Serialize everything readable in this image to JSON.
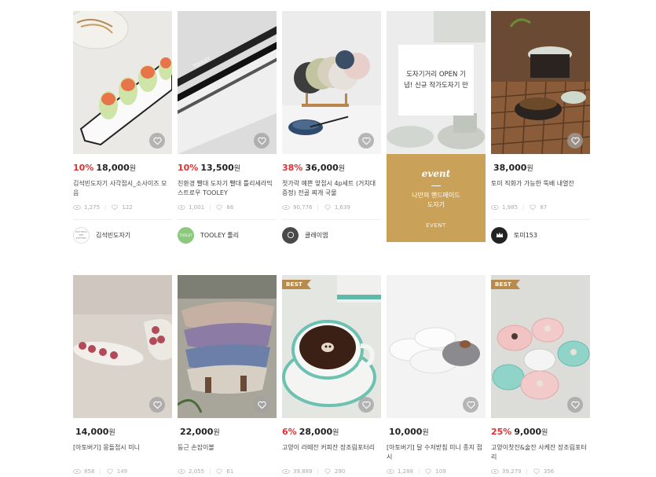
{
  "event": {
    "banner_text": "도자기거리 OPEN 기념! 신규 작가도자기 만",
    "word": "event",
    "desc_line1": "나만의 핸드메이드",
    "desc_line2": "도자기",
    "footer": "EVENT",
    "gold_color": "#c9a158"
  },
  "products": [
    {
      "discount": "10%",
      "price": "18,000",
      "won": "원",
      "title": "김석빈도자기 사각접시_소사이즈 모음",
      "views": "1,275",
      "likes": "122",
      "seller": "김석빈도자기",
      "logo_text": "KIM SEOK BIN POTTERY",
      "logo_color": "#ffffff",
      "best": "",
      "heart_icon": "heart-icon"
    },
    {
      "discount": "10%",
      "price": "13,500",
      "won": "원",
      "title": "친환경 빨대 도자기 빨대 틀리세라믹스트로우 TOOLEY",
      "views": "1,001",
      "likes": "86",
      "seller": "TOOLEY 툴리",
      "logo_text": "TOOLEY",
      "logo_color": "#8cc97f",
      "best": "",
      "heart_icon": "heart-icon"
    },
    {
      "discount": "38%",
      "price": "36,000",
      "won": "원",
      "title": "젓가락 예쁜 앞접시 4p세트 (거치대증정) 전골 찌개 국물",
      "views": "90,776",
      "likes": "1,639",
      "seller": "클레이엠",
      "logo_text": "",
      "logo_color": "#4a4a4a",
      "best": "",
      "heart_icon": "heart-icon"
    },
    {
      "discount": "",
      "price": "38,000",
      "won": "원",
      "title": "토미 직화가 가능한 뚝배 내열잔",
      "views": "1,985",
      "likes": "87",
      "seller": "토미153",
      "logo_text": "",
      "logo_color": "#222222",
      "best": "",
      "heart_icon": "heart-icon"
    },
    {
      "discount": "",
      "price": "14,000",
      "won": "원",
      "title": "[아토버기] 몽돌접시 미니",
      "views": "858",
      "likes": "149",
      "seller": "",
      "logo_text": "",
      "logo_color": "",
      "best": "",
      "heart_icon": "heart-icon"
    },
    {
      "discount": "",
      "price": "22,000",
      "won": "원",
      "title": "둥근 손잡이볼",
      "views": "2,055",
      "likes": "61",
      "seller": "",
      "logo_text": "",
      "logo_color": "",
      "best": "",
      "heart_icon": "heart-icon"
    },
    {
      "discount": "6%",
      "price": "28,000",
      "won": "원",
      "title": "고양이 라떼잔 커피잔 장조림포터리",
      "views": "39,889",
      "likes": "290",
      "seller": "",
      "logo_text": "",
      "logo_color": "",
      "best": "BEST",
      "heart_icon": "heart-icon"
    },
    {
      "discount": "",
      "price": "10,000",
      "won": "원",
      "title": "[아토버기] 달 수저받침 미니 종지 접시",
      "views": "1,288",
      "likes": "109",
      "seller": "",
      "logo_text": "",
      "logo_color": "",
      "best": "",
      "heart_icon": "heart-icon"
    },
    {
      "discount": "25%",
      "price": "9,000",
      "won": "원",
      "title": "고양이찻잔&술잔 사케잔 장조림포터리",
      "views": "39,279",
      "likes": "356",
      "seller": "",
      "logo_text": "",
      "logo_color": "",
      "best": "BEST",
      "heart_icon": "heart-icon"
    }
  ],
  "icons": {
    "views": "eye-icon",
    "likes": "heart-outline-icon"
  },
  "colors": {
    "discount": "#e03131",
    "best_badge": "#b98a4d"
  }
}
